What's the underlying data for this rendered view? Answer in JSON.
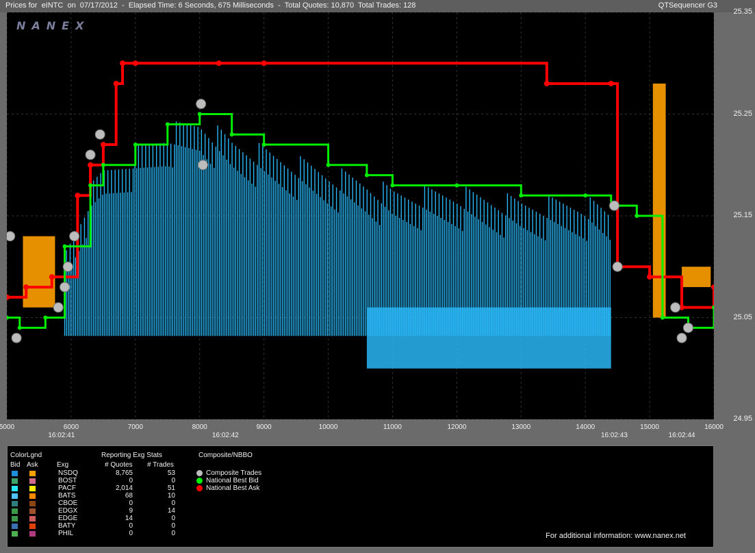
{
  "header": {
    "title": "Prices for  eINTC  on  07/17/2012  -  Elapsed Time: 6 Seconds, 675 Milliseconds  -  Total Quotes: 10,870  Total Trades: 128",
    "app_name": "QTSequencer G3"
  },
  "logo_text": "NANEX",
  "footer": "For additional information: www.nanex.net",
  "colors": {
    "bid_cyan": "#29b6f6",
    "bid_bright": "#4dd0ff",
    "ask_orange": "#ffa000",
    "nbb_green": "#00ee00",
    "nbo_red": "#ff0000",
    "trade_grey": "#bdbdbd"
  },
  "chart_data": {
    "type": "line",
    "title": "Prices for  eINTC  on  07/17/2012",
    "y_ticks": [
      "25.35",
      "25.25",
      "25.15",
      "25.05",
      "24.95"
    ],
    "ylim": [
      24.95,
      25.35
    ],
    "x_ticks": [
      "5000",
      "6000",
      "7000",
      "8000",
      "9000",
      "10000",
      "11000",
      "12000",
      "13000",
      "14000",
      "15000",
      "16000"
    ],
    "xlim": [
      5000,
      16000
    ],
    "time_ticks": [
      {
        "x": 5850,
        "label": "16:02:41"
      },
      {
        "x": 8400,
        "label": "16:02:42"
      },
      {
        "x": 14450,
        "label": "16:02:43"
      },
      {
        "x": 15500,
        "label": "16:02:44"
      }
    ],
    "series": [
      {
        "name": "National Best Ask",
        "x": [
          5000,
          5300,
          5700,
          6100,
          6300,
          6500,
          6700,
          6800,
          7000,
          8300,
          9000,
          13400,
          14400,
          14500,
          15000,
          15500,
          16000
        ],
        "y": [
          25.07,
          25.08,
          25.09,
          25.17,
          25.2,
          25.22,
          25.28,
          25.3,
          25.3,
          25.3,
          25.3,
          25.28,
          25.28,
          25.1,
          25.09,
          25.06,
          25.08
        ]
      },
      {
        "name": "National Best Bid",
        "x": [
          5000,
          5200,
          5600,
          5900,
          6300,
          6500,
          7000,
          7500,
          8000,
          8500,
          9000,
          10000,
          10600,
          11000,
          12000,
          13000,
          14000,
          14400,
          14800,
          15200,
          15600,
          16000
        ],
        "y": [
          25.05,
          25.04,
          25.05,
          25.12,
          25.18,
          25.2,
          25.22,
          25.24,
          25.25,
          25.23,
          25.22,
          25.2,
          25.19,
          25.18,
          25.18,
          25.17,
          25.17,
          25.16,
          25.15,
          25.05,
          25.04,
          25.06
        ]
      },
      {
        "name": "Composite Trades",
        "x": [
          5050,
          5150,
          5800,
          5900,
          5950,
          6050,
          6300,
          6450,
          8020,
          8050,
          14450,
          14500,
          15400,
          15500,
          15600
        ],
        "y": [
          25.13,
          25.03,
          25.06,
          25.08,
          25.1,
          25.13,
          25.21,
          25.23,
          25.26,
          25.2,
          25.16,
          25.1,
          25.06,
          25.03,
          25.04
        ]
      }
    ]
  },
  "legend": {
    "color_legend_label": "ColorLgnd",
    "bid_label": "Bid",
    "ask_label": "Ask",
    "exg_label": "Exg",
    "stats_title": "Reporting Exg Stats",
    "quotes_label": "# Quotes",
    "trades_label": "# Trades",
    "composite_title": "Composite/NBBO",
    "rows": [
      {
        "exg": "NSDQ",
        "quotes": "8,765",
        "trades": "53",
        "bid": "#1f8fdd",
        "ask": "#ffa000"
      },
      {
        "exg": "BOST",
        "quotes": "0",
        "trades": "0",
        "bid": "#3ca36b",
        "ask": "#d26a8c"
      },
      {
        "exg": "PACF",
        "quotes": "2,014",
        "trades": "51",
        "bid": "#29e6f6",
        "ask": "#ffee00"
      },
      {
        "exg": "BATS",
        "quotes": "68",
        "trades": "10",
        "bid": "#4dc3ff",
        "ask": "#ff8c00"
      },
      {
        "exg": "CBOE",
        "quotes": "0",
        "trades": "0",
        "bid": "#2f7f7f",
        "ask": "#8b4513"
      },
      {
        "exg": "EDGX",
        "quotes": "9",
        "trades": "14",
        "bid": "#3a9a4a",
        "ask": "#a0522d"
      },
      {
        "exg": "EDGE",
        "quotes": "14",
        "trades": "0",
        "bid": "#3a9a4a",
        "ask": "#cd5c5c"
      },
      {
        "exg": "BATY",
        "quotes": "0",
        "trades": "0",
        "bid": "#3a6fb0",
        "ask": "#e04000"
      },
      {
        "exg": "PHIL",
        "quotes": "0",
        "trades": "0",
        "bid": "#4caf50",
        "ask": "#b03a80"
      }
    ],
    "composite_items": [
      {
        "label": "Composite Trades",
        "color": "#bdbdbd"
      },
      {
        "label": "National Best Bid",
        "color": "#00ee00"
      },
      {
        "label": "National Best Ask",
        "color": "#ff0000"
      }
    ]
  }
}
